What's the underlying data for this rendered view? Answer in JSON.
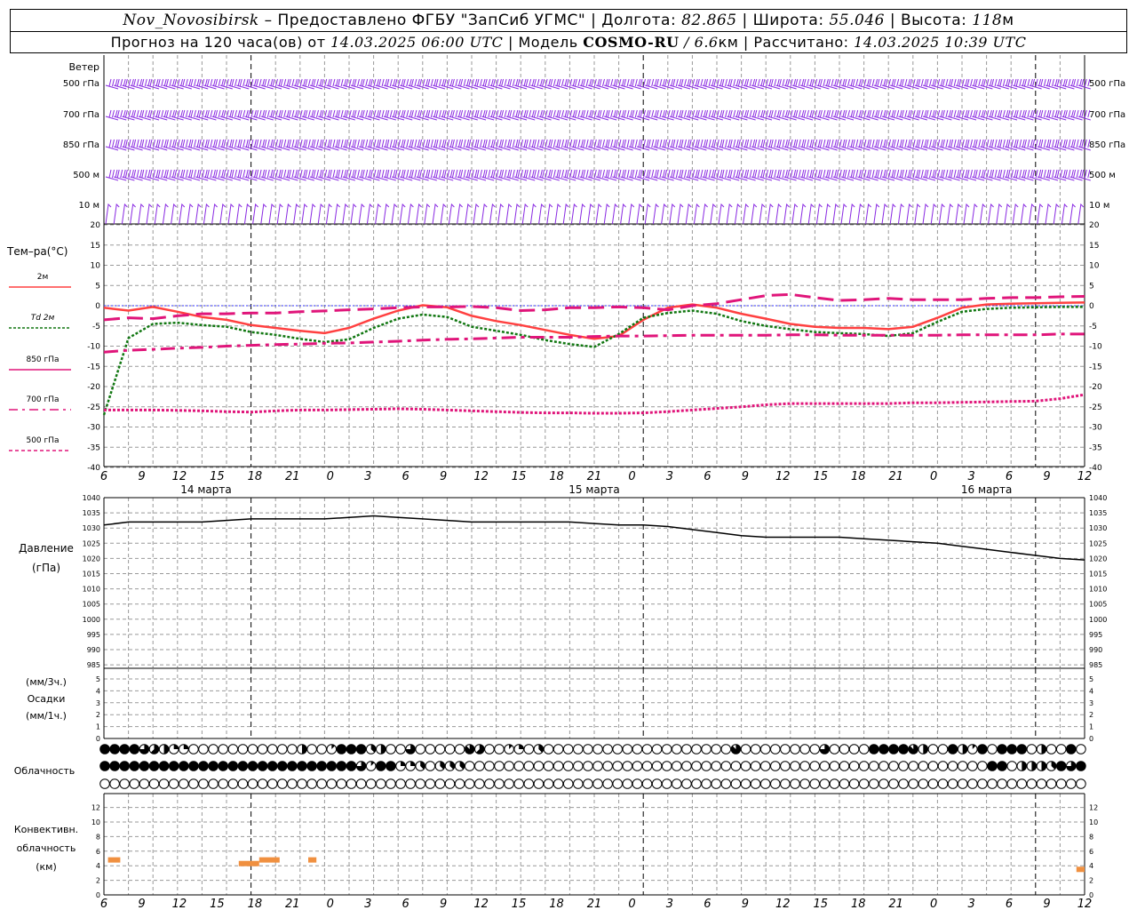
{
  "header": {
    "station": "Nov_Novosibirsk",
    "provided": " – Предоставлено ФГБУ \"ЗапСиб УГМС\" | Долгота: ",
    "lon": "82.865",
    "lat_label": " | Широта: ",
    "lat": "55.046",
    "alt_label": " | Высота: ",
    "alt": "118",
    "alt_unit": "м",
    "forecast_label": "Прогноз на 120 часа(ов) от ",
    "forecast_time": "14.03.2025 06:00 UTC",
    "model_label": "  | Модель ",
    "model": "COSMO-RU",
    "res": " / 6.6",
    "res_unit": "км",
    "computed_label": " | Рассчитано: ",
    "computed": "14.03.2025 10:39 UTC"
  },
  "labels": {
    "wind": "Ветер",
    "wind_levels": [
      "500 гПа",
      "700 гПа",
      "850 гПа",
      "500 м",
      "10  м"
    ],
    "temp": "Тем–ра(°С)",
    "legend": [
      "2м",
      "Td  2м",
      "850 гПа",
      "700 гПа",
      "500 гПа"
    ],
    "pressure": "Давление",
    "pressure_unit": "(гПа)",
    "precip_unit3": "(мм/3ч.)",
    "precip": "Осадки",
    "precip_unit1": "(мм/1ч.)",
    "cloud": "Облачность",
    "conv1": "Конвективн.",
    "conv2": "облачность",
    "conv3": "(км)"
  },
  "colors": {
    "wind": "#8a2be2",
    "t2m": "#ff4040",
    "td2m": "#117711",
    "t850": "#e0157a",
    "t700": "#e0157a",
    "t500": "#e0157a",
    "conv": "#f09040"
  },
  "chart_data": [
    {
      "type": "line",
      "x_hours": [
        0,
        3,
        6,
        9,
        12,
        15,
        18,
        21,
        24,
        27,
        30,
        33,
        36,
        39,
        42,
        45,
        48,
        51,
        54,
        57,
        60,
        63,
        66,
        69,
        72,
        75,
        78,
        81,
        84,
        87,
        90,
        93,
        96,
        99,
        102,
        105,
        108,
        111,
        114,
        117,
        120
      ],
      "series": [
        {
          "name": "2м",
          "values": [
            -0.5,
            -1.2,
            -0.3,
            -1.5,
            -2.8,
            -3.5,
            -4.8,
            -5.5,
            -6.2,
            -6.8,
            -5.5,
            -3.2,
            -1.2,
            0.1,
            -0.4,
            -2.5,
            -3.8,
            -4.8,
            -6.0,
            -7.2,
            -8.2,
            -7.5,
            -3.5,
            -0.5,
            0.3,
            -0.5,
            -2.0,
            -3.2,
            -4.5,
            -5.2,
            -5.5,
            -5.5,
            -5.8,
            -5.2,
            -3.0,
            -0.5,
            0.3,
            0.5,
            0.6,
            0.7,
            0.8
          ]
        },
        {
          "name": "Td  2м",
          "values": [
            -27,
            -8.0,
            -4.5,
            -4.2,
            -4.8,
            -5.2,
            -6.5,
            -7.2,
            -8.2,
            -9.0,
            -8.3,
            -5.5,
            -3.2,
            -2.2,
            -2.8,
            -5.2,
            -6.2,
            -7.2,
            -8.5,
            -9.5,
            -10.2,
            -7.0,
            -3.0,
            -1.8,
            -1.2,
            -2.0,
            -3.8,
            -5.0,
            -5.8,
            -6.5,
            -6.8,
            -7.0,
            -7.5,
            -6.8,
            -4.0,
            -1.5,
            -0.8,
            -0.5,
            -0.4,
            -0.3,
            -0.3
          ]
        },
        {
          "name": "850 гПа",
          "values": [
            -3.5,
            -3.0,
            -3.2,
            -2.5,
            -2.0,
            -2.0,
            -1.8,
            -1.8,
            -1.5,
            -1.3,
            -1.0,
            -0.8,
            -0.5,
            -0.3,
            -0.3,
            -0.2,
            -0.5,
            -1.2,
            -1.0,
            -0.5,
            -0.5,
            -0.3,
            -0.5,
            -1.0,
            0.0,
            0.5,
            1.5,
            2.5,
            2.8,
            2.0,
            1.3,
            1.5,
            1.8,
            1.5,
            1.5,
            1.5,
            1.8,
            2.0,
            2.0,
            2.2,
            2.3
          ]
        },
        {
          "name": "700 гПа",
          "values": [
            -11.5,
            -11.0,
            -10.8,
            -10.5,
            -10.3,
            -10.0,
            -9.8,
            -9.6,
            -9.5,
            -9.3,
            -9.2,
            -9.0,
            -8.8,
            -8.5,
            -8.3,
            -8.2,
            -8.0,
            -7.8,
            -7.8,
            -7.8,
            -7.6,
            -7.5,
            -7.5,
            -7.4,
            -7.3,
            -7.3,
            -7.3,
            -7.3,
            -7.2,
            -7.2,
            -7.3,
            -7.3,
            -7.3,
            -7.3,
            -7.3,
            -7.2,
            -7.2,
            -7.2,
            -7.2,
            -7.0,
            -7.0
          ]
        },
        {
          "name": "500 гПа",
          "values": [
            -25.8,
            -25.8,
            -25.8,
            -25.9,
            -26.0,
            -26.2,
            -26.3,
            -26.0,
            -25.8,
            -25.8,
            -25.7,
            -25.6,
            -25.5,
            -25.6,
            -25.8,
            -26.0,
            -26.2,
            -26.4,
            -26.5,
            -26.5,
            -26.6,
            -26.6,
            -26.5,
            -26.2,
            -25.8,
            -25.4,
            -25.0,
            -24.5,
            -24.2,
            -24.2,
            -24.2,
            -24.2,
            -24.2,
            -24.0,
            -24.0,
            -23.9,
            -23.8,
            -23.7,
            -23.6,
            -23.0,
            -22.0
          ]
        }
      ],
      "ylabel": "Тем–ра(°С)",
      "ylim": [
        -40,
        20
      ],
      "grid": true
    },
    {
      "type": "line",
      "x_hours": [
        0,
        3,
        6,
        9,
        12,
        15,
        18,
        21,
        24,
        27,
        30,
        33,
        36,
        39,
        42,
        45,
        48,
        51,
        54,
        57,
        60,
        63,
        66,
        69,
        72,
        75,
        78,
        81,
        84,
        87,
        90,
        93,
        96,
        99,
        102,
        105,
        108,
        111,
        114,
        117,
        120
      ],
      "series": [
        {
          "name": "Давление",
          "values": [
            1031,
            1032,
            1032,
            1032,
            1032,
            1032.5,
            1033,
            1033,
            1033,
            1033,
            1033.5,
            1034,
            1033.5,
            1033,
            1032.5,
            1032,
            1032,
            1032,
            1032,
            1032,
            1031.5,
            1031,
            1031,
            1030.5,
            1029.5,
            1028.5,
            1027.5,
            1027,
            1027,
            1027,
            1027,
            1026.5,
            1026,
            1025.5,
            1025,
            1024,
            1023,
            1022,
            1021,
            1020,
            1019.5
          ]
        }
      ],
      "ylabel": "Давление (гПа)",
      "ylim": [
        985,
        1040
      ],
      "grid": true
    },
    {
      "type": "bar",
      "ylabel": "Конвективн. облачность (км)",
      "ylim": [
        0,
        13
      ],
      "segments": [
        {
          "x_start": 0.5,
          "x_end": 2,
          "y": 4.8
        },
        {
          "x_start": 16.5,
          "x_end": 19,
          "y": 4.3
        },
        {
          "x_start": 19,
          "x_end": 21.5,
          "y": 4.8
        },
        {
          "x_start": 25,
          "x_end": 26,
          "y": 4.8
        },
        {
          "x_start": 119,
          "x_end": 120,
          "y": 3.5
        }
      ]
    }
  ],
  "axis": {
    "time_ticks": [
      "6",
      "9",
      "12",
      "15",
      "18",
      "21",
      "0",
      "3",
      "6",
      "9",
      "12",
      "15",
      "18",
      "21",
      "0",
      "3",
      "6",
      "9",
      "12",
      "15",
      "18",
      "21",
      "0",
      "3",
      "6",
      "9",
      "12"
    ],
    "dates": [
      "14 марта",
      "15 марта",
      "16 марта"
    ],
    "temp_ticks": [
      "20",
      "15",
      "10",
      "5",
      "0",
      "-5",
      "-10",
      "-15",
      "-20",
      "-25",
      "-30",
      "-35",
      "-40"
    ],
    "pres_ticks": [
      "1040",
      "1035",
      "1030",
      "1025",
      "1020",
      "1015",
      "1010",
      "1005",
      "1000",
      "995",
      "990",
      "985"
    ],
    "precip_ticks": [
      "5",
      "4",
      "3",
      "2",
      "1",
      "0"
    ],
    "conv_ticks": [
      "12",
      "10",
      "8",
      "6",
      "4",
      "2",
      "0"
    ]
  },
  "cloud_rows": [
    "9999654220000000000040019993400600000750012030000000000000000000700000000600009999740094190999840090000",
    "9999999999999999999999999961992230333000000000000000000000000000000000000000000000000000009904443969",
    "0000000000000000000000000000000000000000000000000000000000000000000000000000000000000000000000000000"
  ]
}
